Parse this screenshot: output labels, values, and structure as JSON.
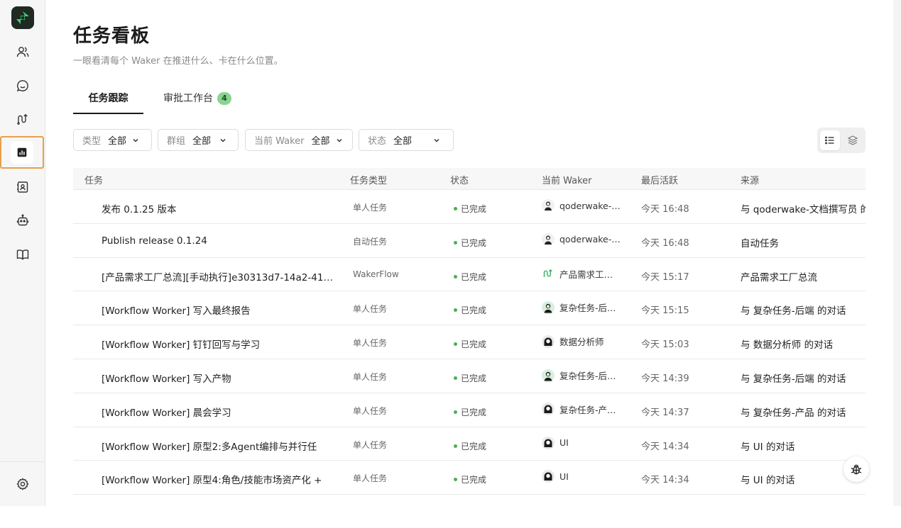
{
  "sidebar": {
    "items": [
      {
        "icon": "users-icon"
      },
      {
        "icon": "chat-icon"
      },
      {
        "icon": "workflow-icon"
      },
      {
        "icon": "chart-icon",
        "active": true
      },
      {
        "icon": "contact-book-icon"
      },
      {
        "icon": "robot-icon"
      },
      {
        "icon": "book-icon"
      }
    ],
    "footer_icon": "settings-icon"
  },
  "header": {
    "title": "任务看板",
    "subtitle": "一眼看清每个 Waker 在推进什么、卡在什么位置。"
  },
  "tabs": [
    {
      "label": "任务跟踪",
      "active": true
    },
    {
      "label": "审批工作台",
      "badge": "4"
    }
  ],
  "filters": [
    {
      "label": "类型",
      "value": "全部"
    },
    {
      "label": "群组",
      "value": "全部"
    },
    {
      "label": "当前 Waker",
      "value": "全部"
    },
    {
      "label": "状态",
      "value": "全部"
    }
  ],
  "table": {
    "columns": [
      "任务",
      "任务类型",
      "状态",
      "当前 Waker",
      "最后活跃",
      "来源"
    ],
    "rows": [
      {
        "task": "发布 0.1.25 版本",
        "type": "单人任务",
        "status": "已完成",
        "waker": "qoderwake-…",
        "avatar": "person",
        "time": "今天 16:48",
        "source": "与 qoderwake-文档撰写员 的"
      },
      {
        "task": "Publish release 0.1.24",
        "type": "自动任务",
        "status": "已完成",
        "waker": "qoderwake-…",
        "avatar": "person",
        "time": "今天 16:48",
        "source": "自动任务"
      },
      {
        "task": "[产品需求工厂总流][手动执行]e30313d7-14a2-41b…",
        "type": "WakerFlow",
        "status": "已完成",
        "waker": "产品需求工…",
        "avatar": "flow",
        "time": "今天 15:17",
        "source": "产品需求工厂总流"
      },
      {
        "task": "[Workflow Worker] 写入最终报告",
        "type": "单人任务",
        "status": "已完成",
        "waker": "复杂任务-后…",
        "avatar": "person-green",
        "time": "今天 15:15",
        "source": "与 复杂任务-后端 的对话"
      },
      {
        "task": "[Workflow Worker] 钉钉回写与学习",
        "type": "单人任务",
        "status": "已完成",
        "waker": "数据分析师",
        "avatar": "person-dark",
        "time": "今天 15:03",
        "source": "与 数据分析师 的对话"
      },
      {
        "task": "[Workflow Worker] 写入产物",
        "type": "单人任务",
        "status": "已完成",
        "waker": "复杂任务-后…",
        "avatar": "person-green",
        "time": "今天 14:39",
        "source": "与 复杂任务-后端 的对话"
      },
      {
        "task": "[Workflow Worker] 晨会学习",
        "type": "单人任务",
        "status": "已完成",
        "waker": "复杂任务-产…",
        "avatar": "person-dark",
        "time": "今天 14:37",
        "source": "与 复杂任务-产品 的对话"
      },
      {
        "task": "[Workflow Worker] 原型2:多Agent编排与并行任",
        "type": "单人任务",
        "status": "已完成",
        "waker": "UI",
        "avatar": "person-dark",
        "time": "今天 14:34",
        "source": "与 UI 的对话"
      },
      {
        "task": "[Workflow Worker] 原型4:角色/技能市场资产化 +",
        "type": "单人任务",
        "status": "已完成",
        "waker": "UI",
        "avatar": "person-dark",
        "time": "今天 14:34",
        "source": "与 UI 的对话"
      }
    ]
  },
  "view_toggle": {
    "options": [
      "list-view-icon",
      "layers-view-icon"
    ],
    "selected": "list-view-icon"
  },
  "fab_icon": "bug-icon",
  "colors": {
    "accent_border": "#e8a04a",
    "badge_bg": "#8ad48f",
    "status_done": "#4caf50",
    "logo_bg": "#1f2a22",
    "logo_mark": "#3fd07a"
  }
}
